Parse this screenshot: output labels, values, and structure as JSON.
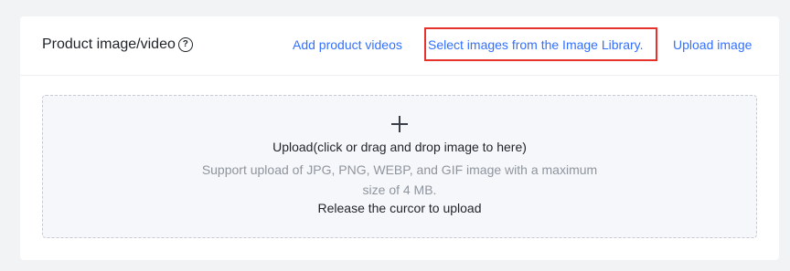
{
  "header": {
    "title": "Product image/video",
    "help_icon": "question-circle-icon",
    "help_glyph": "?"
  },
  "actions": {
    "add_videos": "Add product videos",
    "select_library": "Select images from the Image Library.",
    "upload_image": "Upload image"
  },
  "colors": {
    "link": "#3370ff",
    "highlight_border": "#e5322d",
    "text_primary": "#1f2329",
    "text_secondary": "#8f959e"
  },
  "dropzone": {
    "icon": "plus-icon",
    "main_text": "Upload(click or drag and drop image to here)",
    "hint_text": "Support upload of JPG, PNG, WEBP, and GIF image with a maximum size of 4 MB.",
    "release_text": "Release the curcor to upload"
  }
}
